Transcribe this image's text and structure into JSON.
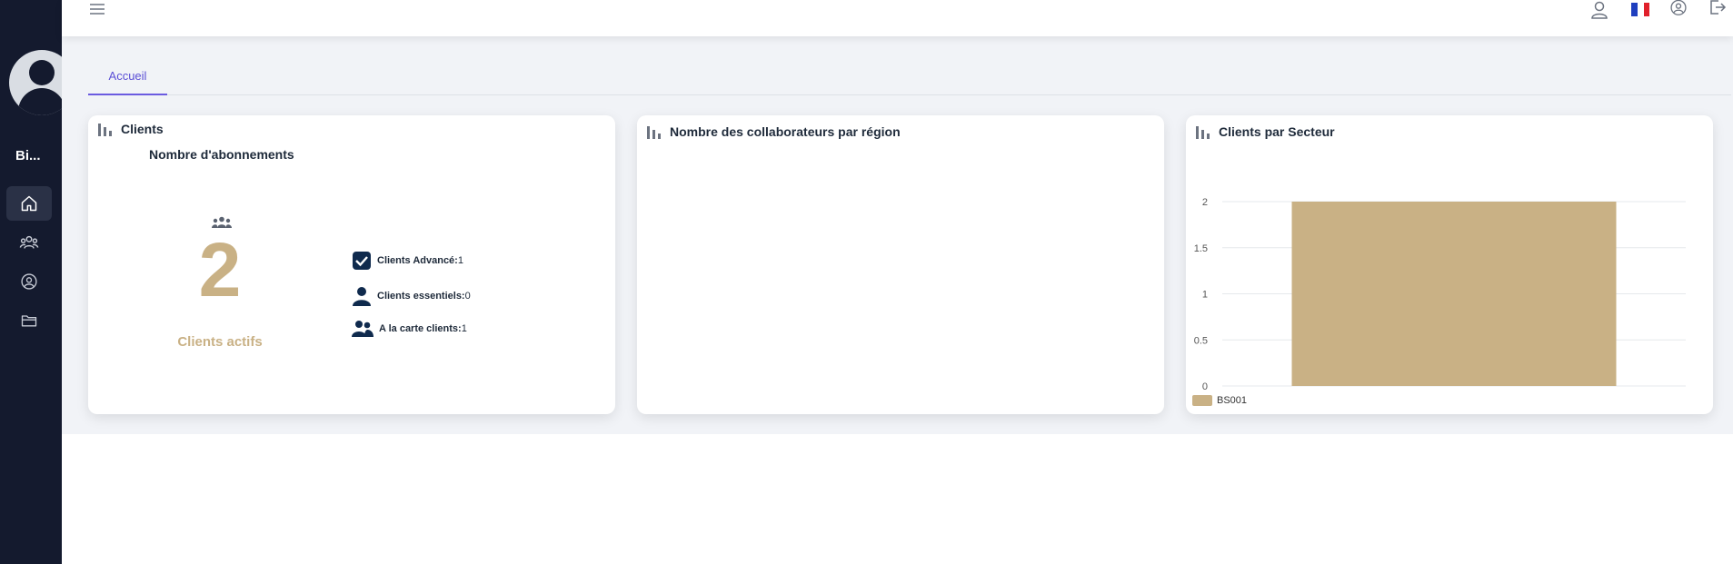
{
  "sidebar": {
    "user_name": "Bi...",
    "items": [
      {
        "icon": "home-icon",
        "active": true
      },
      {
        "icon": "users-group-icon",
        "active": false
      },
      {
        "icon": "user-circle-icon",
        "active": false
      },
      {
        "icon": "folder-icon",
        "active": false
      }
    ]
  },
  "topbar": {
    "icons": [
      "menu-icon",
      "user-icon",
      "flag-france-icon",
      "account-circle-icon",
      "logout-icon"
    ]
  },
  "tabs": [
    {
      "label": "Accueil",
      "active": true
    }
  ],
  "cards": {
    "clients": {
      "title": "Clients",
      "subtitle": "Nombre d'abonnements",
      "active_count": "2",
      "active_label": "Clients actifs",
      "stats": [
        {
          "label": "Clients Advancé:",
          "value": "1",
          "icon": "checkbox-checked-icon"
        },
        {
          "label": "Clients essentiels:",
          "value": "0",
          "icon": "person-icon"
        },
        {
          "label": "A la carte clients:",
          "value": "1",
          "icon": "people-icon"
        }
      ]
    },
    "collaborateurs": {
      "title": "Nombre des collaborateurs par région"
    },
    "secteur": {
      "title": "Clients par Secteur"
    }
  },
  "chart_data": {
    "type": "bar",
    "categories": [
      ""
    ],
    "series": [
      {
        "name": "BS001",
        "values": [
          2
        ]
      }
    ],
    "ylim": [
      0,
      2
    ],
    "yticks": [
      "0",
      "0.5",
      "1",
      "1.5",
      "2"
    ],
    "grid": true,
    "legend": "bottom-left",
    "colors": {
      "bar": "#c9b185"
    }
  },
  "colors": {
    "sidebar": "#141a2e",
    "accent": "#6b5be0",
    "gold": "#c9b185",
    "navy": "#0f2a4d"
  }
}
